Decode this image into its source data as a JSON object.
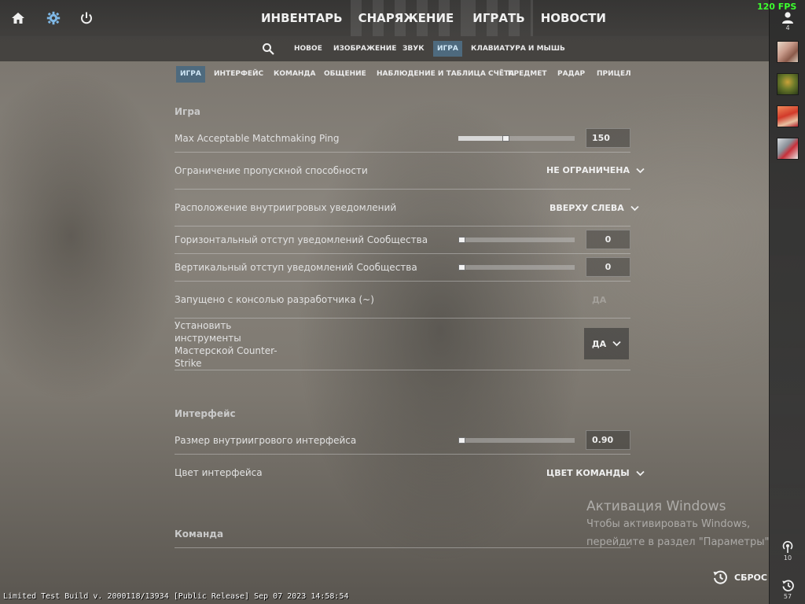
{
  "fps": "120 FPS",
  "top_icons": [
    "home-icon",
    "gear-icon",
    "power-icon"
  ],
  "main_nav": [
    {
      "label": "ИНВЕНТАРЬ",
      "active": false
    },
    {
      "label": "СНАРЯЖЕНИЕ",
      "active": true
    },
    {
      "label": "ИГРАТЬ",
      "active": true
    },
    {
      "label": "НОВОСТИ",
      "active": false
    }
  ],
  "sub_tabs": {
    "new": "НОВОЕ",
    "video": "ИЗОБРАЖЕНИЕ",
    "audio": "ЗВУК",
    "game": "ИГРА",
    "keyboard": "КЛАВИАТУРА И МЫШЬ",
    "active": "ИГРА"
  },
  "category_tabs": {
    "game": "ИГРА",
    "interface": "ИНТЕРФЕЙС",
    "team": "КОМАНДА",
    "communication": "ОБЩЕНИЕ",
    "spectator": "НАБЛЮДЕНИЕ И ТАБЛИЦА СЧЁТА",
    "item": "ПРЕДМЕТ",
    "radar": "РАДАР",
    "crosshair": "ПРИЦЕЛ",
    "active": "ИГРА"
  },
  "sections": {
    "game": "Игра",
    "interface": "Интерфейс",
    "team": "Команда"
  },
  "settings": {
    "ping": {
      "label": "Max Acceptable Matchmaking Ping",
      "value": "150",
      "fraction": 0.4
    },
    "bandwidth": {
      "label": "Ограничение пропускной способности",
      "value": "НЕ ОГРАНИЧЕНА"
    },
    "notif_position": {
      "label": "Расположение внутриигровых уведомлений",
      "value": "ВВЕРХУ СЛЕВА"
    },
    "notif_h_offset": {
      "label": "Горизонтальный отступ уведомлений Сообщества",
      "value": "0",
      "fraction": 0.0
    },
    "notif_v_offset": {
      "label": "Вертикальный отступ уведомлений Сообщества",
      "value": "0",
      "fraction": 0.0
    },
    "dev_console": {
      "label": "Запущено с консолью разработчика (~)",
      "value": "ДА"
    },
    "workshop_tools": {
      "label_lines": [
        "Установить",
        "инструменты",
        "Мастерской Counter-",
        "Strike"
      ],
      "value": "ДА"
    },
    "hud_scale": {
      "label": "Размер внутриигрового интерфейса",
      "value": "0.90",
      "fraction": 0.0
    },
    "hud_color": {
      "label": "Цвет интерфейса",
      "value": "ЦВЕТ КОМАНДЫ"
    }
  },
  "sidebar": {
    "friends_count": "4",
    "bottom_count_1": "10",
    "bottom_count_2": "57"
  },
  "activation": {
    "title": "Активация Windows",
    "line1": "Чтобы активировать Windows,",
    "line2": "перейдите в раздел \"Параметры\""
  },
  "reset_label": "СБРОС",
  "build_info": "Limited Test Build v. 2000118/13934 [Public Release] Sep 07 2023 14:58:54"
}
